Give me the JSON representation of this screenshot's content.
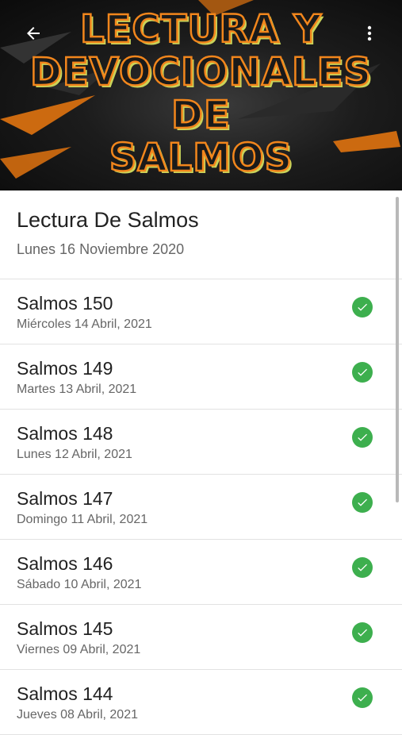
{
  "header": {
    "banner_lines": [
      "LECTURA Y",
      "DEVOCIONALES",
      "DE",
      "SALMOS"
    ],
    "back_icon": "arrow-left-icon",
    "menu_icon": "more-vertical-icon",
    "accent_color": "#f2861c"
  },
  "summary": {
    "title": "Lectura De Salmos",
    "date": "Lunes 16 Noviembre 2020"
  },
  "readings": [
    {
      "title": "Salmos 150",
      "date": "Miércoles 14 Abril, 2021",
      "status_icon": "check-circle-icon"
    },
    {
      "title": "Salmos 149",
      "date": "Martes 13 Abril, 2021",
      "status_icon": "check-circle-icon"
    },
    {
      "title": "Salmos 148",
      "date": "Lunes 12 Abril, 2021",
      "status_icon": "check-circle-icon"
    },
    {
      "title": "Salmos 147",
      "date": "Domingo 11 Abril, 2021",
      "status_icon": "check-circle-icon"
    },
    {
      "title": "Salmos 146",
      "date": "Sábado 10 Abril, 2021",
      "status_icon": "check-circle-icon"
    },
    {
      "title": "Salmos 145",
      "date": "Viernes 09 Abril, 2021",
      "status_icon": "check-circle-icon"
    },
    {
      "title": "Salmos 144",
      "date": "Jueves 08 Abril, 2021",
      "status_icon": "check-circle-icon"
    }
  ],
  "colors": {
    "check": "#3daf4e",
    "divider": "#e2e2e2"
  }
}
